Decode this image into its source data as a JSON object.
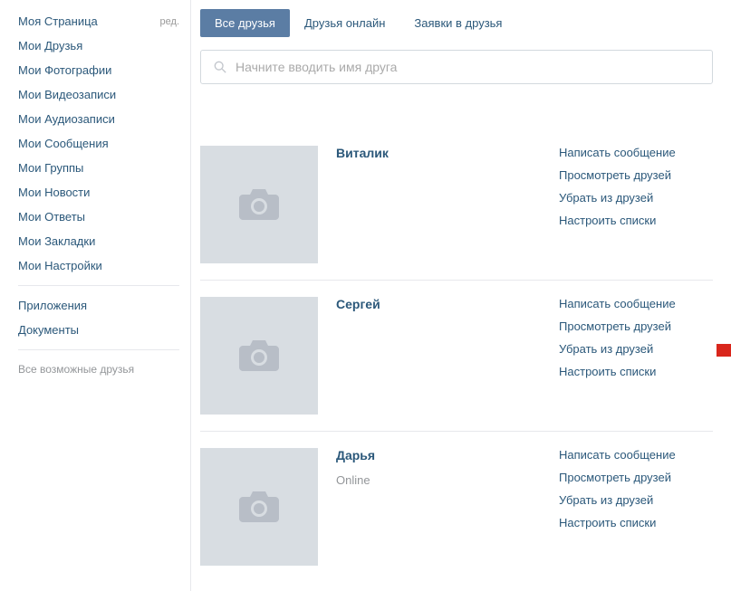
{
  "sidebar": {
    "items": [
      {
        "label": "Моя Страница",
        "edit": "ред."
      },
      {
        "label": "Мои Друзья"
      },
      {
        "label": "Мои Фотографии"
      },
      {
        "label": "Мои Видеозаписи"
      },
      {
        "label": "Мои Аудиозаписи"
      },
      {
        "label": "Мои Сообщения"
      },
      {
        "label": "Мои Группы"
      },
      {
        "label": "Мои Новости"
      },
      {
        "label": "Мои Ответы"
      },
      {
        "label": "Мои Закладки"
      },
      {
        "label": "Мои Настройки"
      }
    ],
    "secondary": [
      {
        "label": "Приложения"
      },
      {
        "label": "Документы"
      }
    ],
    "footer": "Все возможные друзья"
  },
  "tabs": [
    {
      "label": "Все друзья",
      "active": true
    },
    {
      "label": "Друзья онлайн",
      "active": false
    },
    {
      "label": "Заявки в друзья",
      "active": false
    }
  ],
  "search": {
    "placeholder": "Начните вводить имя друга"
  },
  "friends": [
    {
      "name": "Виталик",
      "status": ""
    },
    {
      "name": "Сергей",
      "status": ""
    },
    {
      "name": "Дарья",
      "status": "Online"
    }
  ],
  "actions": {
    "message": "Написать сообщение",
    "view": "Просмотреть друзей",
    "remove": "Убрать из друзей",
    "lists": "Настроить списки"
  }
}
